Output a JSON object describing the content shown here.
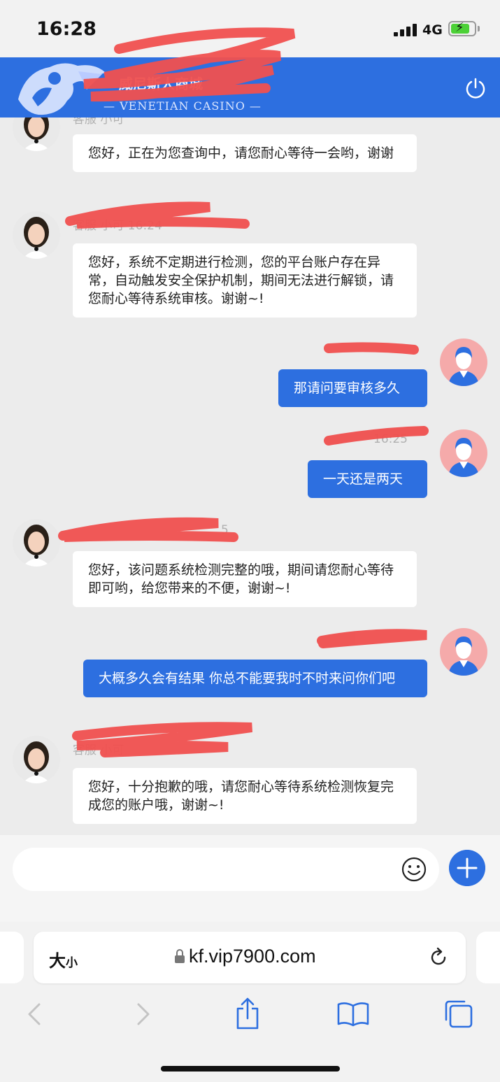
{
  "status_bar": {
    "time": "16:28",
    "network": "4G"
  },
  "header": {
    "title": "威尼斯人商城",
    "subtitle": "— VENETIAN CASINO —"
  },
  "messages": [
    {
      "side": "in",
      "meta": "客服 小可",
      "text": "您好，正在为您查询中，请您耐心等待一会哟，谢谢"
    },
    {
      "side": "in",
      "meta": "客服 小可 16:24",
      "text": "您好，系统不定期进行检测，您的平台账户存在异常，自动触发安全保护机制，期间无法进行解锁，请您耐心等待系统审核。谢谢~!"
    },
    {
      "side": "out",
      "meta": "",
      "text": "那请问要审核多久"
    },
    {
      "side": "out",
      "meta": "16:25",
      "text": "一天还是两天"
    },
    {
      "side": "in",
      "meta": "5",
      "text": "您好，该问题系统检测完整的哦，期间请您耐心等待即可哟，给您带来的不便，谢谢~!"
    },
    {
      "side": "out",
      "meta": "",
      "text": "大概多久会有结果 你总不能要我时不时来问你们吧"
    },
    {
      "side": "in",
      "meta": "客服 小可",
      "text": "您好，十分抱歉的哦，请您耐心等待系统检测恢复完成您的账户哦，谢谢~!"
    }
  ],
  "composer": {
    "placeholder": ""
  },
  "safari": {
    "text_size_label": "大",
    "text_size_small": "小",
    "url": "kf.vip7900.com"
  },
  "colors": {
    "brand": "#2d6fe0",
    "scribble": "#f0504f"
  }
}
